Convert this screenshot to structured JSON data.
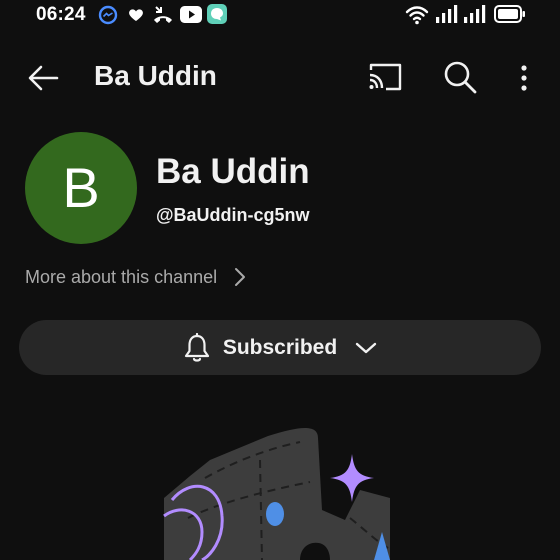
{
  "status_bar": {
    "time": "06:24",
    "icons": [
      "messenger-icon",
      "heart-icon",
      "missed-call-icon",
      "youtube-icon",
      "chat-app-icon"
    ],
    "right_icons": [
      "wifi-icon",
      "signal-icon",
      "signal-icon",
      "battery-icon"
    ]
  },
  "app_bar": {
    "title": "Ba Uddin",
    "icons": [
      "back-arrow-icon",
      "cast-icon",
      "search-icon",
      "more-vert-icon"
    ]
  },
  "channel": {
    "avatar_letter": "B",
    "avatar_color": "#33691e",
    "name": "Ba Uddin",
    "handle": "@BaUddin-cg5nw",
    "more_about_label": "More about this channel"
  },
  "subscribe": {
    "label": "Subscribed",
    "icons": [
      "bell-icon",
      "chevron-down-icon"
    ]
  },
  "colors": {
    "background": "#0f0f0f",
    "button_background": "#272727",
    "text_primary": "#f1f1f1",
    "text_secondary": "#aaaaaa",
    "accent_purple": "#b28cff",
    "accent_blue": "#4f8fe6"
  }
}
